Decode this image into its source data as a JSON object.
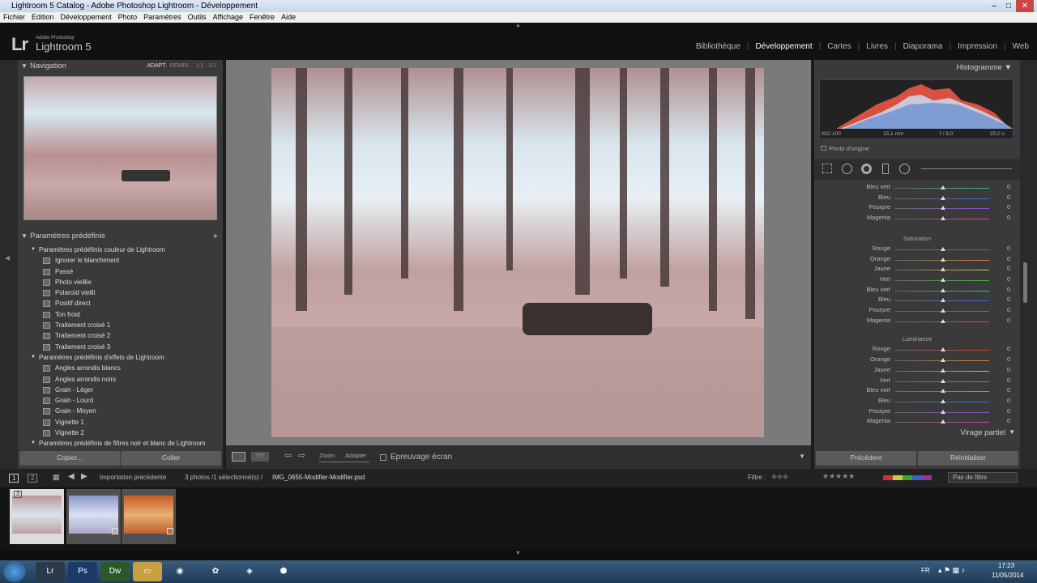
{
  "window": {
    "title": "Lightroom 5 Catalog - Adobe Photoshop Lightroom - Développement"
  },
  "menu": [
    "Fichier",
    "Edition",
    "Développement",
    "Photo",
    "Paramètres",
    "Outils",
    "Affichage",
    "Fenêtre",
    "Aide"
  ],
  "app": {
    "logo": "Lr",
    "brand_sub": "Adobe Photoshop",
    "brand_name": "Lightroom 5"
  },
  "modules": [
    "Bibliothèque",
    "Développement",
    "Cartes",
    "Livres",
    "Diaporama",
    "Impression",
    "Web"
  ],
  "active_module": "Développement",
  "navigator": {
    "title": "Navigation",
    "options": [
      "ADAPT.",
      "REMPL.",
      "1:1",
      "3:1"
    ]
  },
  "presets": {
    "title": "Paramètres prédéfinis",
    "add": "+",
    "groups": [
      {
        "name": "Paramètres prédéfinis couleur de Lightroom",
        "items": [
          "Ignorer le blanchiment",
          "Passé",
          "Photo vieillie",
          "Polaroïd vieilli",
          "Positif direct",
          "Ton froid",
          "Traitement croisé 1",
          "Traitement croisé 2",
          "Traitement croisé 3"
        ]
      },
      {
        "name": "Paramètres prédéfinis d'effets de Lightroom",
        "items": [
          "Angles arrondis blancs",
          "Angles arrondis noirs",
          "Grain - Léger",
          "Grain - Lourd",
          "Grain - Moyen",
          "Vignette 1",
          "Vignette 2"
        ]
      },
      {
        "name": "Paramètres prédéfinis de filtres noir et blanc de Lightroom",
        "items": []
      }
    ]
  },
  "left_buttons": {
    "copy": "Copier...",
    "paste": "Coller"
  },
  "toolbar": {
    "zoom": "Zoom",
    "fit": "Adapter",
    "proof": "Epreuvage écran"
  },
  "histogram": {
    "title": "Histogramme",
    "iso": "ISO 100",
    "focal": "15,1 mm",
    "aperture": "f / 8,0",
    "shutter": "25,0 s",
    "original": "Photo d'origine"
  },
  "hsl": {
    "top_rows": [
      {
        "label": "Bleu vert",
        "value": "0",
        "color": "#3cb4a0"
      },
      {
        "label": "Bleu",
        "value": "0",
        "color": "#3c6ad2"
      },
      {
        "label": "Pourpre",
        "value": "0",
        "color": "#8a4ad2"
      },
      {
        "label": "Magenta",
        "value": "0",
        "color": "#d23caa"
      }
    ],
    "saturation": {
      "title": "Saturation",
      "rows": [
        {
          "label": "Rouge",
          "value": "0",
          "color": "#d23c3c"
        },
        {
          "label": "Orange",
          "value": "0",
          "color": "#d28a3c"
        },
        {
          "label": "Jaune",
          "value": "0",
          "color": "#d2c83c"
        },
        {
          "label": "Vert",
          "value": "0",
          "color": "#3cb43c"
        },
        {
          "label": "Bleu vert",
          "value": "0",
          "color": "#3cb4a0"
        },
        {
          "label": "Bleu",
          "value": "0",
          "color": "#3c6ad2"
        },
        {
          "label": "Pourpre",
          "value": "0",
          "color": "#8a4ad2"
        },
        {
          "label": "Magenta",
          "value": "0",
          "color": "#d23caa"
        }
      ]
    },
    "luminance": {
      "title": "Luminance",
      "rows": [
        {
          "label": "Rouge",
          "value": "0",
          "color": "#d23c3c"
        },
        {
          "label": "Orange",
          "value": "0",
          "color": "#d28a3c"
        },
        {
          "label": "Jaune",
          "value": "0",
          "color": "#d2c83c"
        },
        {
          "label": "Vert",
          "value": "0",
          "color": "#3cb43c"
        },
        {
          "label": "Bleu vert",
          "value": "0",
          "color": "#3cb4a0"
        },
        {
          "label": "Bleu",
          "value": "0",
          "color": "#3c6ad2"
        },
        {
          "label": "Pourpre",
          "value": "0",
          "color": "#8a4ad2"
        },
        {
          "label": "Magenta",
          "value": "0",
          "color": "#d23caa"
        }
      ]
    },
    "split_toning": "Virage partiel"
  },
  "right_buttons": {
    "previous": "Précédent",
    "reset": "Réinitialiser"
  },
  "filmstrip": {
    "page1": "1",
    "page2": "2",
    "source": "Importation précédente",
    "count": "3 photos /1 sélectionné(s) /",
    "filename": "IMG_0655-Modifier-Modifier.psd",
    "filter_label": "Filtre :",
    "filter_value": "Pas de filtre",
    "badge": "3"
  },
  "taskbar": {
    "lang": "FR",
    "time": "17:23",
    "date": "11/05/2014"
  }
}
